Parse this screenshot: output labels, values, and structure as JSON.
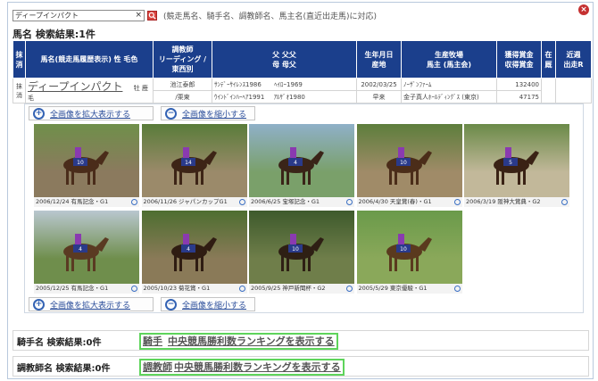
{
  "search": {
    "value": "ディープインパクト",
    "clear": "×",
    "note": "(競走馬名、騎手名、調教師名、馬主名(直近出走馬)に対応)"
  },
  "horse_section": {
    "title": "馬名  検索結果:1件",
    "headers": {
      "mark": "抹消",
      "name": "馬名(競走馬履歴表示)  性 毛色",
      "trainer": "調教師\nリーディング / 東西別",
      "pedigree": "父    父父\n母    母父",
      "birth": "生年月日\n産地",
      "farm": "生産牧場\n馬主 (馬主会)",
      "prize": "獲得賞金\n収得賞金",
      "active": "在\n厩",
      "recent": "近週\n出走R"
    },
    "row": {
      "mark": "抹消",
      "name": "ディープインパクト",
      "sex_color": "牡 鹿毛",
      "trainer": "池江泰郎",
      "trainer_region": "/栗東",
      "sire": "ｻﾝﾃﾞｰｻｲﾚﾝｽ1986",
      "sire_sire": "ﾍｲﾛｰ1969",
      "dam": "ｳｲﾝﾄﾞｲﾝﾊｰﾍｱ1991",
      "dam_sire": "ｱﾙｻﾞｵ1980",
      "birth": "2002/03/25",
      "birthplace": "早来",
      "farm": "ﾉｰｻﾞﾝﾌｧｰﾑ",
      "owner": "金子真人ﾎｰﾙﾃﾞｨﾝｸﾞｽ  (東京)",
      "prize": "132400",
      "earned": "47175"
    }
  },
  "gallery": {
    "zoom_in": "全画像を拡大表示する",
    "zoom_out": "全画像を縮小する",
    "photos": [
      {
        "caption": "2006/12/24 有馬記念・G1",
        "number": "10"
      },
      {
        "caption": "2006/11/26 ジャパンカップG1",
        "number": "14"
      },
      {
        "caption": "2006/6/25 宝塚記念・G1",
        "number": "4"
      },
      {
        "caption": "2006/4/30 天皇賞(春)・G1",
        "number": "10"
      },
      {
        "caption": "2006/3/19 阪神大賞典・G2",
        "number": "5"
      },
      {
        "caption": "2005/12/25 有馬記念・G1",
        "number": "4"
      },
      {
        "caption": "2005/10/23 菊花賞・G1",
        "number": "4"
      },
      {
        "caption": "2005/9/25 神戸新聞杯・G2",
        "number": "10"
      },
      {
        "caption": "2005/5/29 東京優駿・G1",
        "number": "10"
      }
    ]
  },
  "jockey_section": {
    "title": "騎手名  検索結果:0件",
    "link_label": "騎手",
    "link_text": "中央競馬勝利数ランキングを表示する"
  },
  "trainer_section": {
    "title": "調教師名  検索結果:0件",
    "link_label": "調教師",
    "link_text": "中央競馬勝利数ランキングを表示する"
  },
  "colors": {
    "header_bg": "#1b3f8c",
    "mark_red": "#d02020",
    "highlight_green": "#5ed45b"
  }
}
